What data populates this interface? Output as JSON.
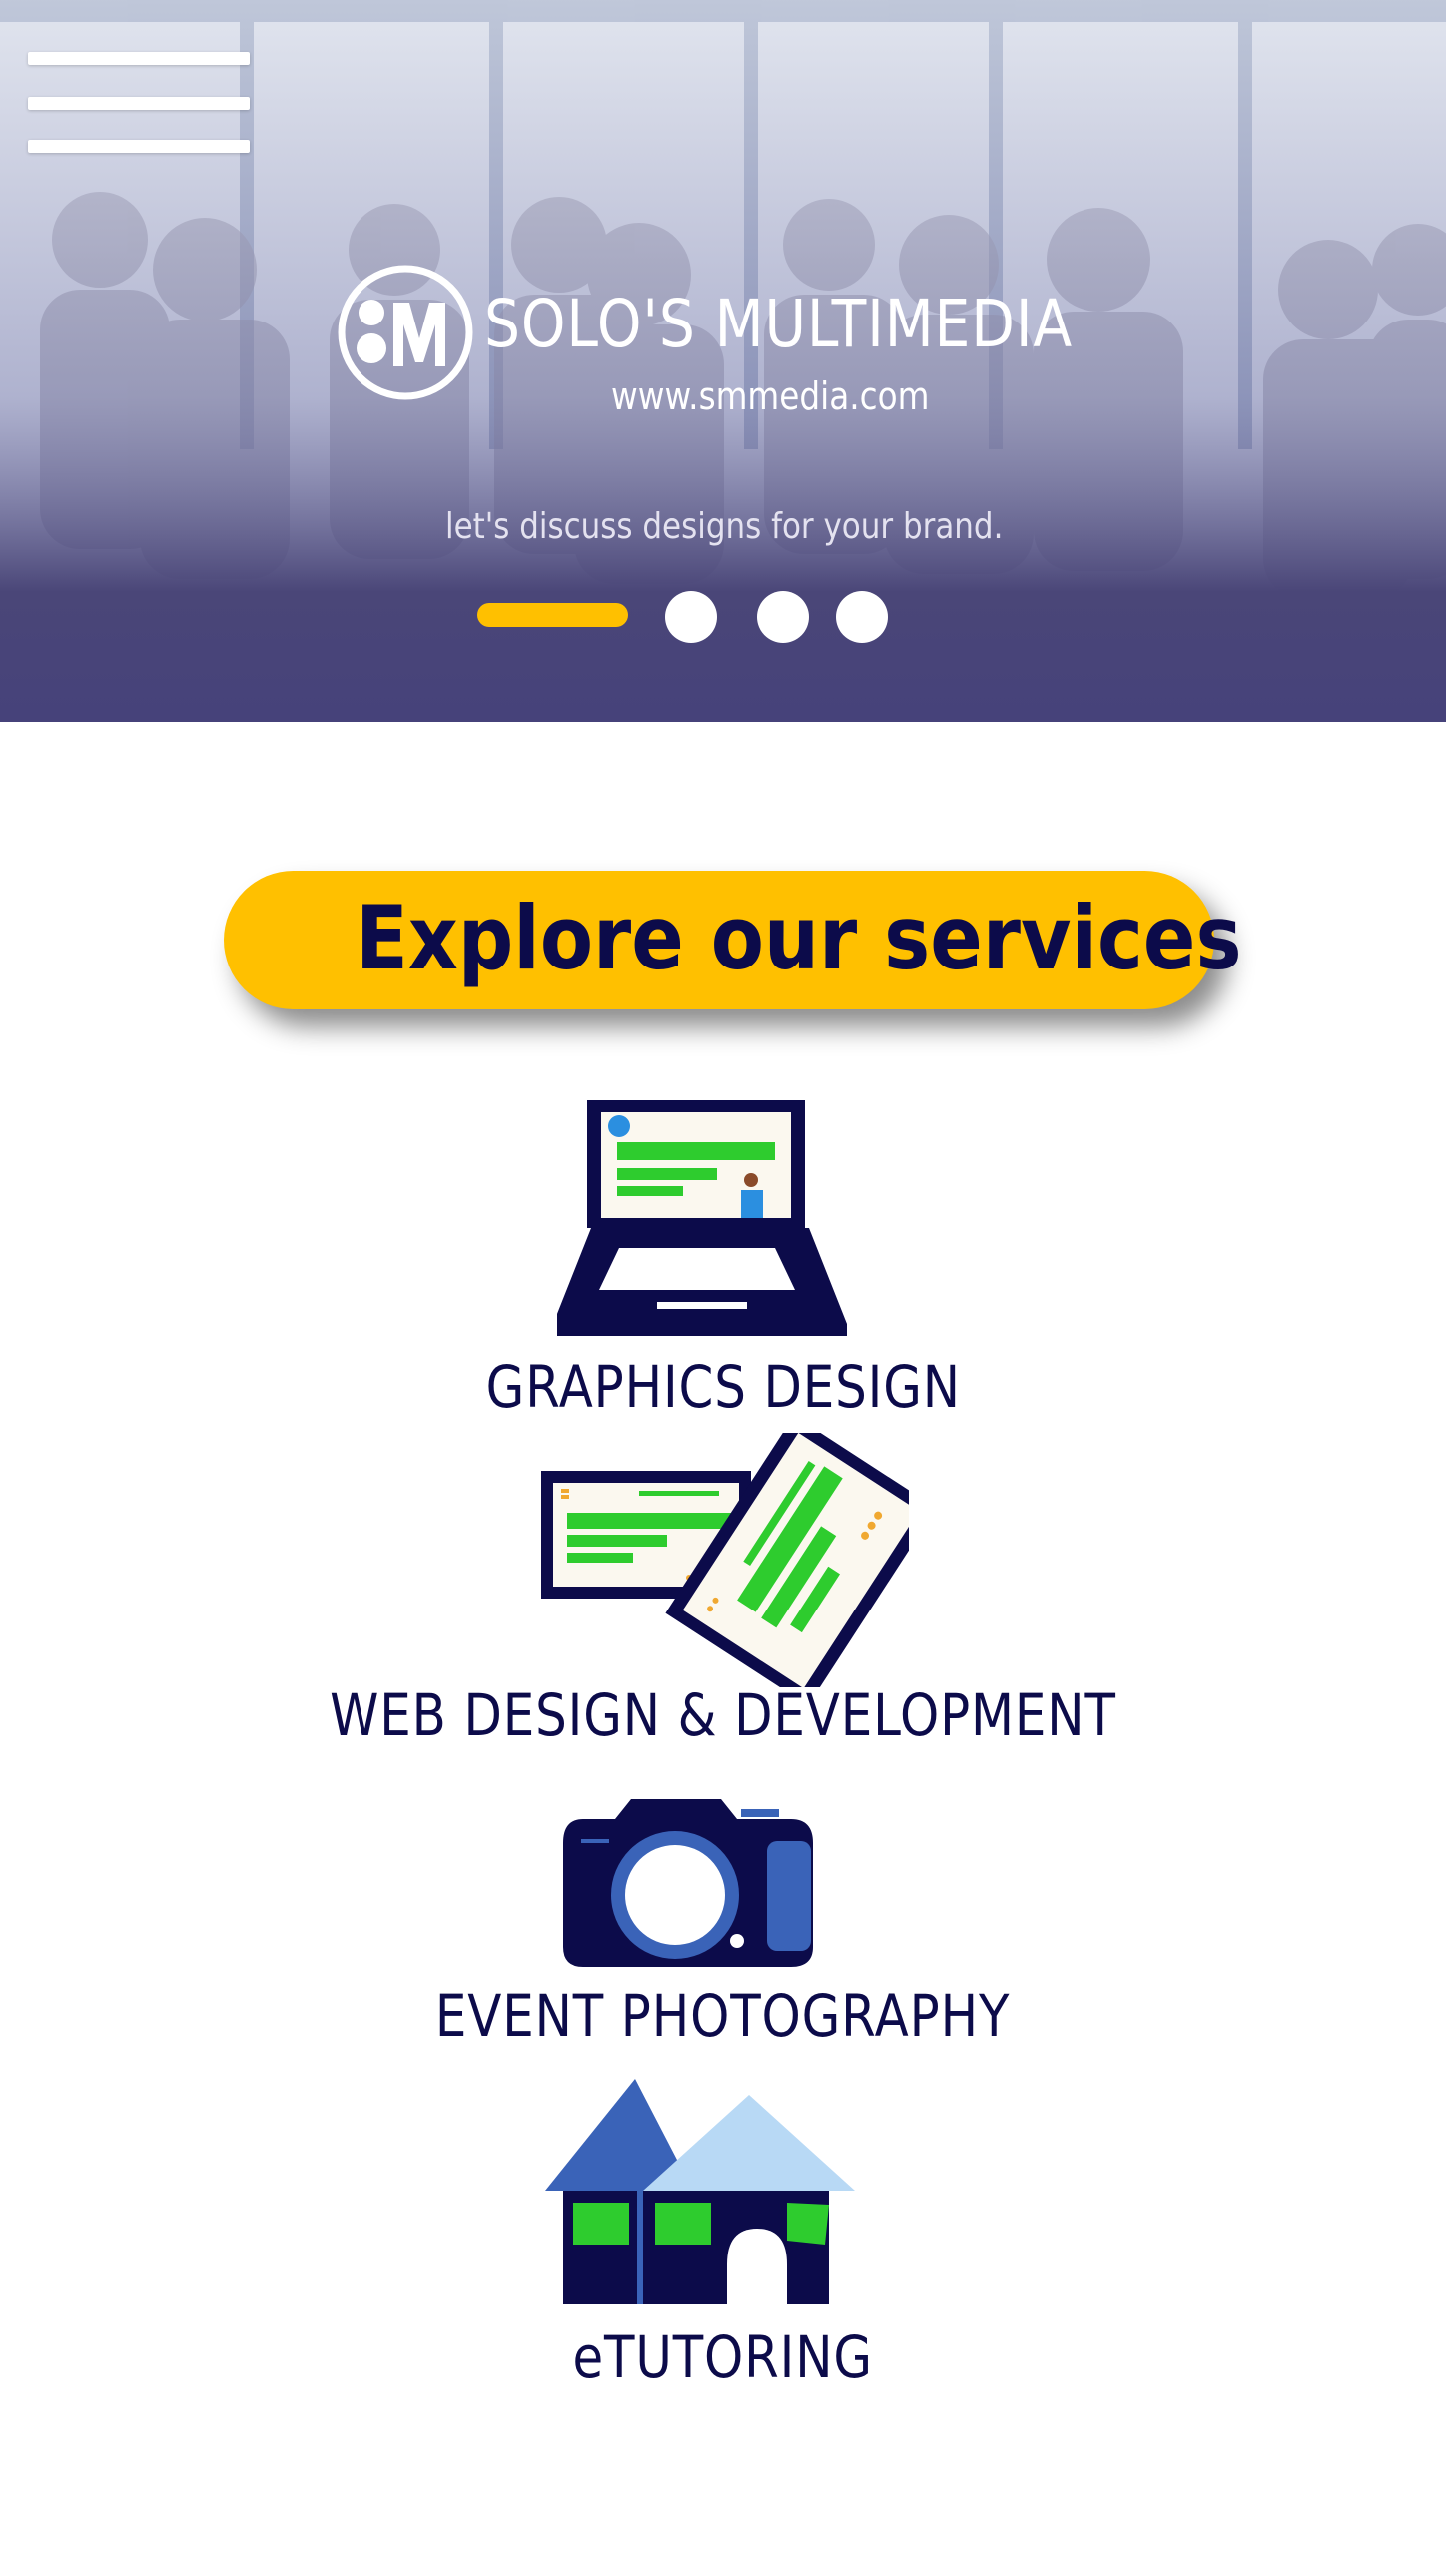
{
  "hero": {
    "brand_name": "SOLO'S MULTIMEDIA",
    "brand_url": "www.smmedia.com",
    "tagline": "let's discuss designs for your brand.",
    "slides_total": 4,
    "active_slide": 1
  },
  "cta": {
    "label": "Explore our services"
  },
  "services": [
    {
      "label": "GRAPHICS DESIGN",
      "icon": "laptop-icon"
    },
    {
      "label": "WEB DESIGN & DEVELOPMENT",
      "icon": "web-pages-icon"
    },
    {
      "label": "EVENT PHOTOGRAPHY",
      "icon": "camera-icon"
    },
    {
      "label": "eTUTORING",
      "icon": "school-house-icon"
    }
  ],
  "colors": {
    "accent": "#ffc000",
    "navy": "#0c0b4a",
    "hero_overlay": "#4a4678",
    "green": "#2ecc2e",
    "blue": "#3a63b8",
    "light_blue": "#b8d9f5"
  }
}
